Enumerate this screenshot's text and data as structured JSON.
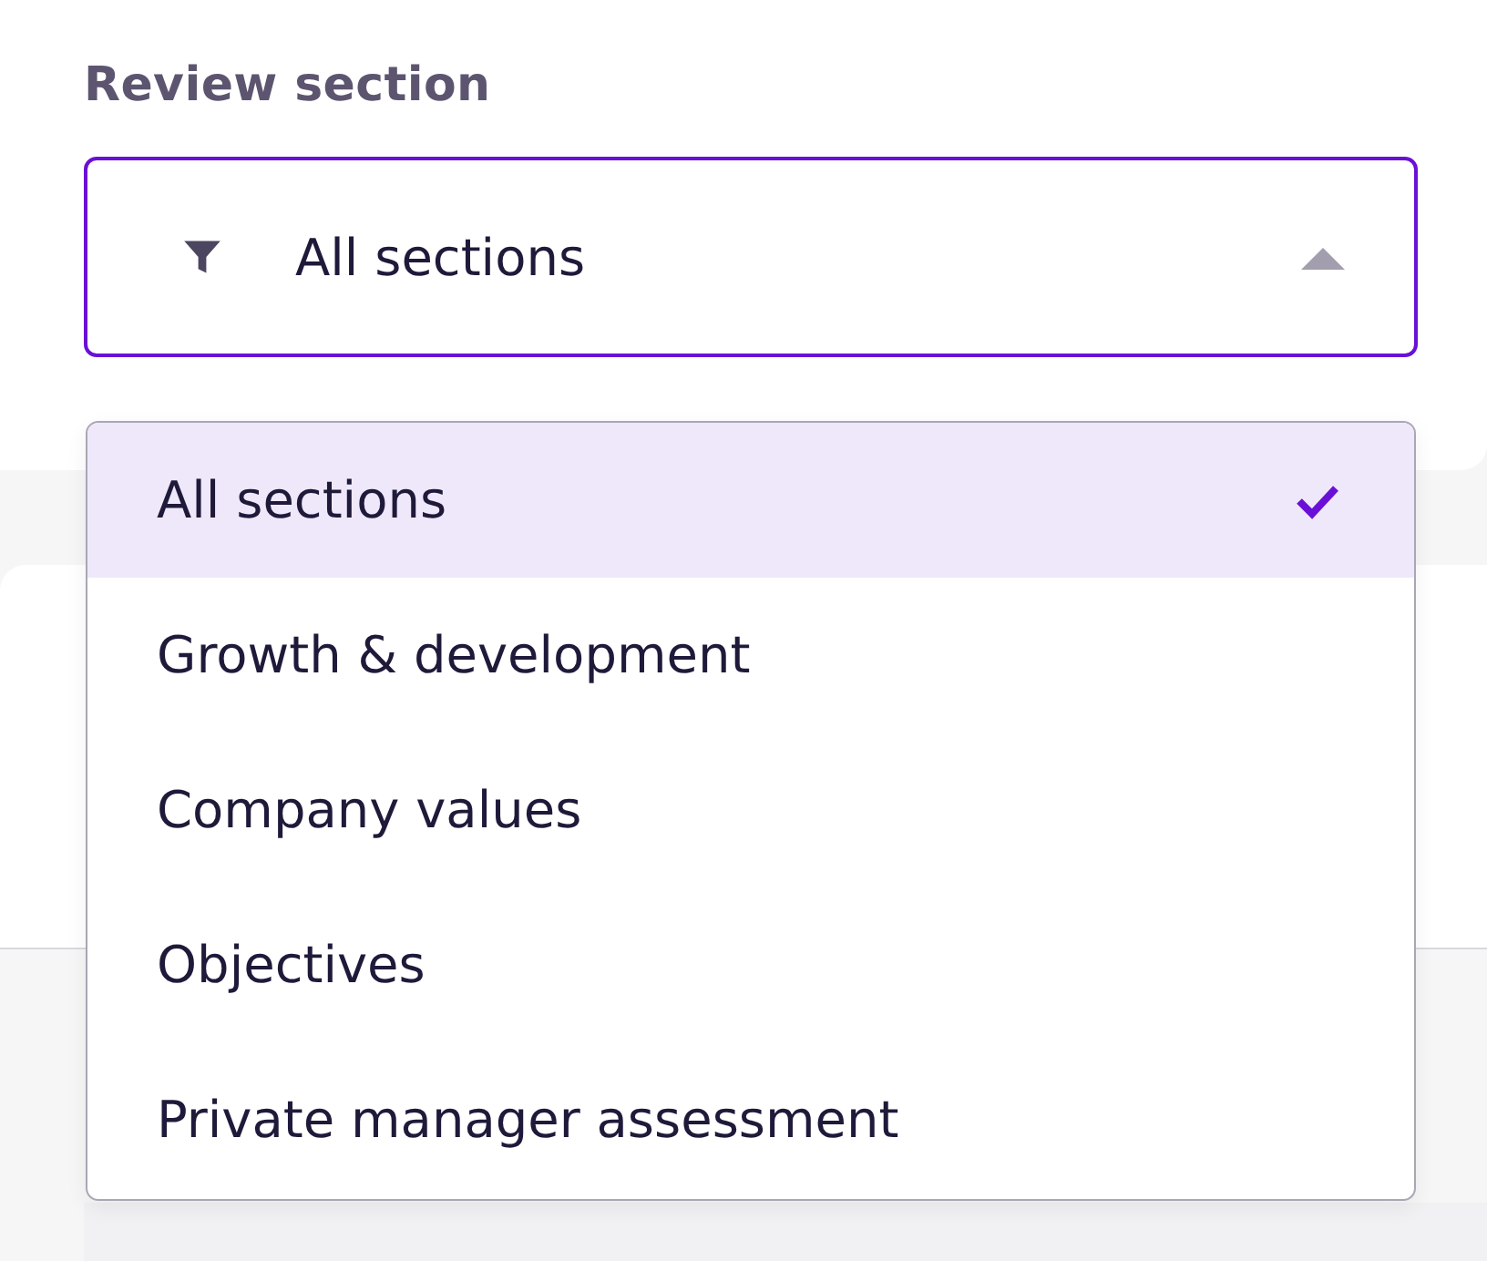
{
  "field_label": "Review section",
  "select": {
    "value": "All sections",
    "expanded": true
  },
  "options": [
    {
      "label": "All sections",
      "selected": true
    },
    {
      "label": "Growth & development",
      "selected": false
    },
    {
      "label": "Company values",
      "selected": false
    },
    {
      "label": "Objectives",
      "selected": false
    },
    {
      "label": "Private manager assessment",
      "selected": false
    }
  ]
}
